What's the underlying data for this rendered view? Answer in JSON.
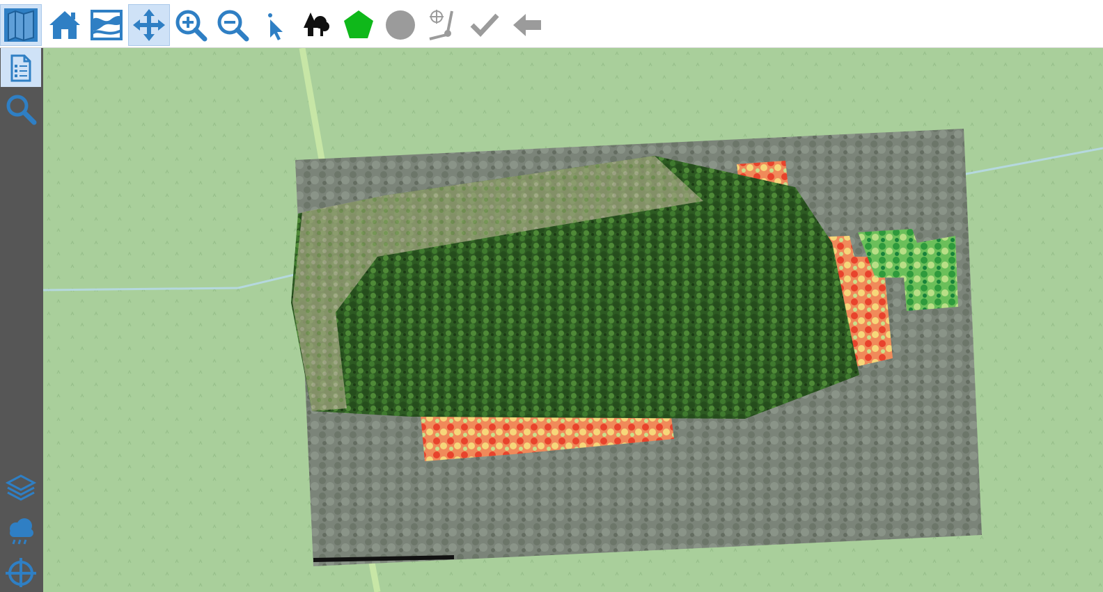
{
  "toolbar": {
    "tools": [
      {
        "name": "map-panel",
        "icon": "map-icon",
        "active": true
      },
      {
        "name": "home",
        "icon": "home-icon",
        "active": false
      },
      {
        "name": "full-extent",
        "icon": "map-extent-icon",
        "active": false
      },
      {
        "name": "pan",
        "icon": "pan-arrows-icon",
        "active": true
      },
      {
        "name": "zoom-in",
        "icon": "zoom-in-icon",
        "active": false
      },
      {
        "name": "zoom-out",
        "icon": "zoom-out-icon",
        "active": false
      },
      {
        "name": "select",
        "icon": "pointer-icon",
        "active": false
      },
      {
        "name": "trees",
        "icon": "trees-icon",
        "active": false
      },
      {
        "name": "draw-polygon",
        "icon": "pentagon-icon",
        "active": false
      },
      {
        "name": "draw-circle",
        "icon": "circle-icon",
        "active": false
      },
      {
        "name": "measure",
        "icon": "measure-icon",
        "active": false
      },
      {
        "name": "confirm",
        "icon": "checkmark-icon",
        "active": false
      },
      {
        "name": "back",
        "icon": "back-arrow-icon",
        "active": false
      }
    ]
  },
  "sidebar": {
    "items": [
      {
        "name": "report",
        "icon": "report-icon",
        "active": true
      },
      {
        "name": "search",
        "icon": "search-icon",
        "active": false
      },
      {
        "name": "layers",
        "icon": "layers-icon",
        "active": false
      },
      {
        "name": "cloud-weather",
        "icon": "cloud-icon",
        "active": false
      },
      {
        "name": "locate",
        "icon": "crosshair-icon",
        "active": false
      }
    ]
  },
  "colors": {
    "accent": "#2f7fc4",
    "icon_gray": "#9b9b9b",
    "polygon_green": "#0fb81a",
    "map_background": "#a9cf9b",
    "sidebar": "#565656"
  }
}
